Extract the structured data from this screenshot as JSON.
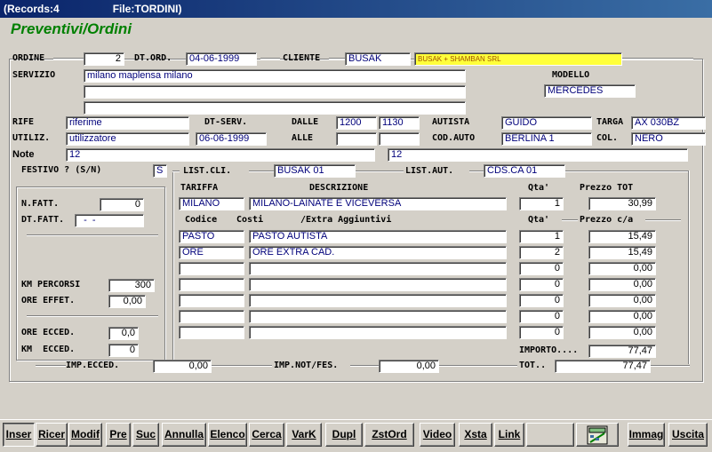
{
  "window": {
    "records": "(Records:4",
    "file": "File:TORDINI)"
  },
  "app_title": "Preventivi/Ordini",
  "ordine": {
    "label": "ORDINE",
    "value": "2"
  },
  "dt_ord": {
    "label": "DT.ORD.",
    "value": "04-06-1999"
  },
  "cliente": {
    "label": "CLIENTE",
    "code": "BUSAK",
    "name": "BUSAK + SHAMBAN SRL"
  },
  "servizio": {
    "label": "SERVIZIO",
    "lines": [
      "milano maplensa milano",
      "",
      ""
    ]
  },
  "modello": {
    "label": "MODELLO",
    "value": "MERCEDES"
  },
  "rife": {
    "label": "RIFE",
    "value": "riferime"
  },
  "dt_serv": {
    "label": "DT-SERV.",
    "value": "06-06-1999"
  },
  "dalle": {
    "label": "DALLE",
    "from": "1200",
    "to": "1130"
  },
  "alle": {
    "label": "ALLE",
    "from": "",
    "to": ""
  },
  "autista": {
    "label": "AUTISTA",
    "value": "GUIDO"
  },
  "targa": {
    "label": "TARGA",
    "value": "AX 030BZ"
  },
  "utiliz": {
    "label": "UTILIZ.",
    "value": "utilizzatore"
  },
  "cod_auto": {
    "label": "COD.AUTO",
    "value": "BERLINA 1"
  },
  "col": {
    "label": "COL.",
    "value": "NERO"
  },
  "note": {
    "label": "Note",
    "value1": "12",
    "value2": "12"
  },
  "festivo": {
    "label": "FESTIVO ? (S/N)",
    "value": "S"
  },
  "list_cli": {
    "label": "LIST.CLI.",
    "value": "BUSAK 01"
  },
  "list_aut": {
    "label": "LIST.AUT.",
    "value": "CDS.CA 01"
  },
  "tariffa": {
    "headers": {
      "tariffa": "TARIFFA",
      "descrizione": "DESCRIZIONE",
      "qta": "Qta'",
      "prezzo": "Prezzo TOT"
    },
    "code": "MILANO",
    "desc": "MILANO-LAINATE E VICEVERSA",
    "qta": "1",
    "prezzo": "30,99"
  },
  "extra": {
    "headers": {
      "codice": "Codice",
      "costi": "Costi",
      "extra": "/Extra Aggiuntivi",
      "qta": "Qta'",
      "prezzo": "Prezzo c/a"
    },
    "rows": [
      {
        "code": "PASTO",
        "desc": "PASTO AUTISTA",
        "qta": "1",
        "prezzo": "15,49"
      },
      {
        "code": "ORE",
        "desc": "ORE EXTRA CAD.",
        "qta": "2",
        "prezzo": "15,49"
      },
      {
        "code": "",
        "desc": "",
        "qta": "0",
        "prezzo": "0,00"
      },
      {
        "code": "",
        "desc": "",
        "qta": "0",
        "prezzo": "0,00"
      },
      {
        "code": "",
        "desc": "",
        "qta": "0",
        "prezzo": "0,00"
      },
      {
        "code": "",
        "desc": "",
        "qta": "0",
        "prezzo": "0,00"
      },
      {
        "code": "",
        "desc": "",
        "qta": "0",
        "prezzo": "0,00"
      }
    ]
  },
  "importo": {
    "label": "IMPORTO....",
    "value": "77,47"
  },
  "tot": {
    "label": "TOT..",
    "value": "77,47"
  },
  "fatt": {
    "n_fatt_label": "N.FATT.",
    "n_fatt": "0",
    "dt_fatt_label": "DT.FATT.",
    "dt_fatt": "  -  -",
    "km_perc_label": "KM PERCORSI",
    "km_perc": "300",
    "ore_eff_label": "ORE EFFET.",
    "ore_eff": "0,00",
    "ore_ecc_label": "ORE ECCED.",
    "ore_ecc": "0,0",
    "km_ecc_label": "KM  ECCED.",
    "km_ecc": "0"
  },
  "imp_ecced": {
    "label": "IMP.ECCED.",
    "value": "0,00"
  },
  "imp_not": {
    "label": "IMP.NOT/FES.",
    "value": "0,00"
  },
  "buttons": {
    "inser": "Inser",
    "ricer": "Ricer",
    "modif": "Modif",
    "pre": "Pre",
    "suc": "Suc",
    "annulla": "Annulla",
    "elenco": "Elenco",
    "cerca": "Cerca",
    "vark": "VarK",
    "dupl": "Dupl",
    "zstord": "ZstOrd",
    "video": "Video",
    "xsta": "Xsta",
    "link": "Link",
    "immag": "Immag",
    "uscita": "Uscita"
  },
  "icons": {
    "calc": "calculator-icon"
  }
}
